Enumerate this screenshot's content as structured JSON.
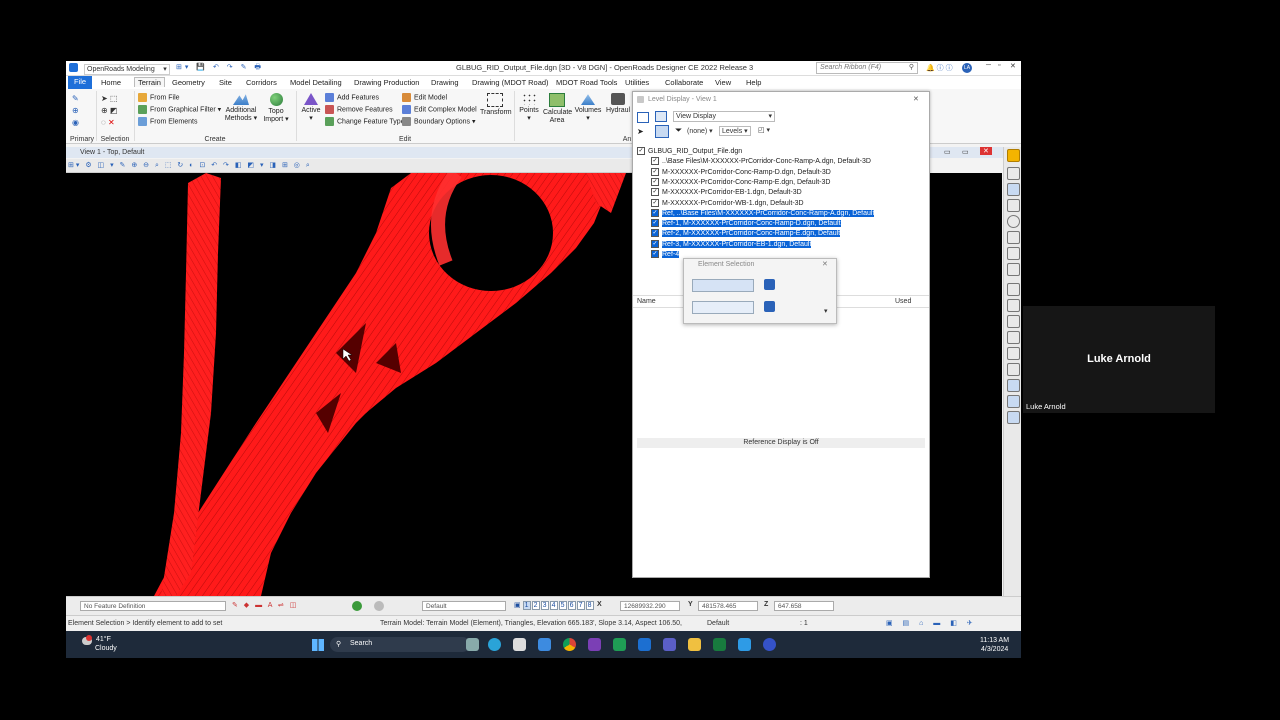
{
  "app": {
    "workspace": "OpenRoads Modeling",
    "title": "GLBUG_RID_Output_File.dgn [3D - V8 DGN] - OpenRoads Designer CE 2022 Release 3",
    "search_placeholder": "Search Ribbon (F4)",
    "user_initials": "LA"
  },
  "tabs": [
    "File",
    "Home",
    "Terrain",
    "Geometry",
    "Site",
    "Corridors",
    "Model Detailing",
    "Drawing Production",
    "Drawing",
    "Drawing (MDOT Road)",
    "MDOT Road Tools",
    "Utilities",
    "Collaborate",
    "View",
    "Help"
  ],
  "active_tab": "Terrain",
  "ribbon": {
    "primary_label": "Primary",
    "selection_label": "Selection",
    "create": {
      "from_file": "From File",
      "from_graphical_filter": "From Graphical Filter",
      "from_elements": "From Elements",
      "additional_methods": "Additional Methods",
      "topo_import": "Topo Import",
      "group": "Create"
    },
    "edit": {
      "active": "Active",
      "add_features": "Add Features",
      "remove_features": "Remove Features",
      "change_feature_type": "Change Feature Type",
      "edit_model": "Edit Model",
      "edit_complex_model": "Edit Complex Model",
      "boundary_options": "Boundary Options",
      "transform": "Transform",
      "group": "Edit"
    },
    "analysis": {
      "points": "Points",
      "calculate_area": "Calculate Area",
      "volumes": "Volumes",
      "hydraulics": "Hydraul",
      "group": "An"
    }
  },
  "view": {
    "title": "View 1 - Top, Default"
  },
  "level_display": {
    "title": "Level Display - View 1",
    "mode": "View Display",
    "filter": "(none)",
    "levels_label": "Levels",
    "tree": [
      {
        "label": "GLBUG_RID_Output_File.dgn",
        "selected": false,
        "root": true
      },
      {
        "label": "..\\Base Files\\M-XXXXXX-PrCorridor-Conc-Ramp-A.dgn, Default-3D",
        "selected": false
      },
      {
        "label": "M-XXXXXX-PrCorridor-Conc-Ramp-D.dgn, Default-3D",
        "selected": false
      },
      {
        "label": "M-XXXXXX-PrCorridor-Conc-Ramp-E.dgn, Default-3D",
        "selected": false
      },
      {
        "label": "M-XXXXXX-PrCorridor-EB-1.dgn, Default-3D",
        "selected": false
      },
      {
        "label": "M-XXXXXX-PrCorridor-WB-1.dgn, Default-3D",
        "selected": false
      },
      {
        "label": "Ref, ..\\Base Files\\M-XXXXXX-PrCorridor-Conc-Ramp-A.dgn, Default",
        "selected": true
      },
      {
        "label": "Ref-1, M-XXXXXX-PrCorridor-Conc-Ramp-D.dgn, Default",
        "selected": true
      },
      {
        "label": "Ref-2, M-XXXXXX-PrCorridor-Conc-Ramp-E.dgn, Default",
        "selected": true
      },
      {
        "label": "Ref-3, M-XXXXXX-PrCorridor-EB-1.dgn, Default",
        "selected": true
      },
      {
        "label": "Ref-4",
        "selected": true
      }
    ],
    "col_name": "Name",
    "col_used": "Used",
    "footer": "Reference Display is Off"
  },
  "element_selection": {
    "title": "Element Selection"
  },
  "bottom": {
    "feature_definition": "No Feature Definition",
    "level": "Default",
    "views": [
      "1",
      "2",
      "3",
      "4",
      "5",
      "6",
      "7",
      "8"
    ],
    "x_label": "X",
    "x_value": "12689932.290",
    "y_label": "Y",
    "y_value": "481578.465",
    "z_label": "Z",
    "z_value": "647.658"
  },
  "status": {
    "prompt": "Element Selection > Identify element to add to set",
    "info": "Terrain Model: Terrain Model (Element), Triangles, Elevation 665.183', Slope 3.14, Aspect 106.50,",
    "level": "Default",
    "count": ": 1"
  },
  "taskbar": {
    "temp": "41°F",
    "weather": "Cloudy",
    "search": "Search",
    "time": "11:13 AM",
    "date": "4/3/2024"
  },
  "participant": {
    "name_big": "Luke Arnold",
    "name_small": "Luke Arnold"
  },
  "colors": {
    "accent": "#1e6fd9",
    "selection": "#0a64d7",
    "model": "#ff1a1a",
    "canvas": "#000000"
  }
}
